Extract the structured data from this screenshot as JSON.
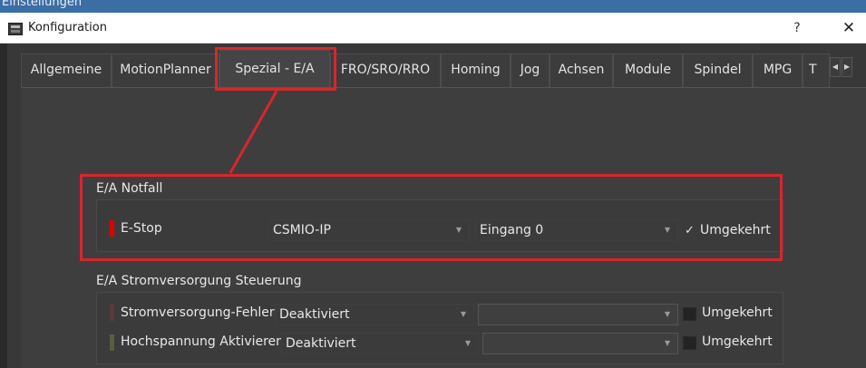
{
  "background_window": {
    "title": "Einstellungen"
  },
  "window": {
    "title": "Konfiguration",
    "help_glyph": "?",
    "close_glyph": "✕"
  },
  "tabs": [
    {
      "label": "Allgemeine"
    },
    {
      "label": "MotionPlanner"
    },
    {
      "label": "Spezial - E/A",
      "active": true
    },
    {
      "label": "FRO/SRO/RRO"
    },
    {
      "label": "Homing"
    },
    {
      "label": "Jog"
    },
    {
      "label": "Achsen"
    },
    {
      "label": "Module"
    },
    {
      "label": "Spindel"
    },
    {
      "label": "MPG"
    },
    {
      "label": "T"
    }
  ],
  "tab_scroll": {
    "left": "◀",
    "right": "▶"
  },
  "emergency": {
    "title": "E/A Notfall",
    "row": {
      "label": "E-Stop",
      "indicator_color": "#e00000",
      "device": "CSMIO-IP",
      "input": "Eingang 0",
      "inverted_checked": true,
      "check_glyph": "✓",
      "inverted_label": "Umgekehrt"
    }
  },
  "power": {
    "title": "E/A Stromversorgung Steuerung",
    "rows": [
      {
        "label": "Stromversorgung-Fehler",
        "indicator_color": "#5a3a3a",
        "device": "Deaktiviert",
        "input": "",
        "inverted_checked": false,
        "inverted_label": "Umgekehrt"
      },
      {
        "label": "Hochspannung Aktivieren",
        "indicator_color": "#56603e",
        "device": "Deaktiviert",
        "input": "",
        "inverted_checked": false,
        "inverted_label": "Umgekehrt"
      }
    ]
  },
  "combo_arrow": "▼",
  "colors": {
    "highlight": "#d8262e",
    "dialog_bg": "#383838",
    "page_bg": "#3e3e3e"
  }
}
